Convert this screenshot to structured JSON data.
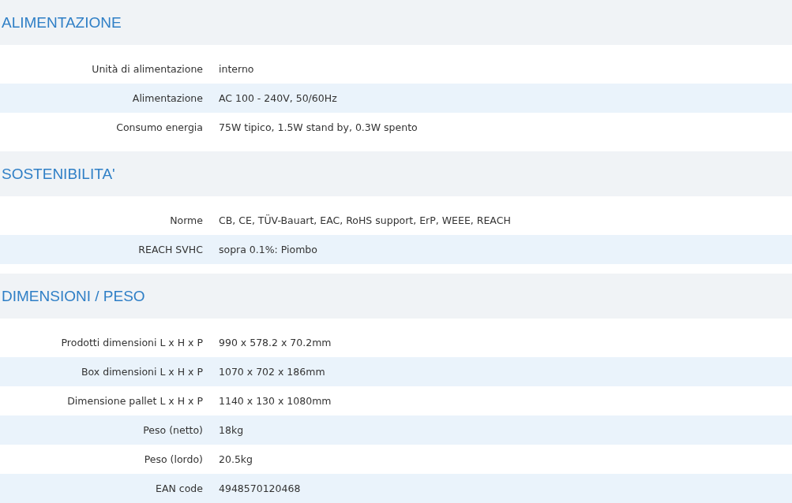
{
  "sections": [
    {
      "title": "ALIMENTAZIONE",
      "rows": [
        {
          "label": "Unità di alimentazione",
          "value": "interno"
        },
        {
          "label": "Alimentazione",
          "value": "AC 100 - 240V, 50/60Hz"
        },
        {
          "label": "Consumo energia",
          "value": "75W tipico, 1.5W stand by, 0.3W spento"
        }
      ]
    },
    {
      "title": "SOSTENIBILITA'",
      "rows": [
        {
          "label": "Norme",
          "value": "CB, CE, TÜV-Bauart, EAC, RoHS support, ErP, WEEE, REACH"
        },
        {
          "label": "REACH SVHC",
          "value": "sopra 0.1%: Piombo"
        }
      ]
    },
    {
      "title": "DIMENSIONI / PESO",
      "rows": [
        {
          "label": "Prodotti dimensioni L x H x P",
          "value": "990 x 578.2 x 70.2mm"
        },
        {
          "label": "Box dimensioni L x H x P",
          "value": "1070 x 702 x 186mm"
        },
        {
          "label": "Dimensione pallet L x H x P",
          "value": "1140 x 130 x 1080mm"
        },
        {
          "label": "Peso (netto)",
          "value": "18kg"
        },
        {
          "label": "Peso (lordo)",
          "value": "20.5kg"
        },
        {
          "label": "EAN code",
          "value": "4948570120468"
        }
      ]
    }
  ]
}
